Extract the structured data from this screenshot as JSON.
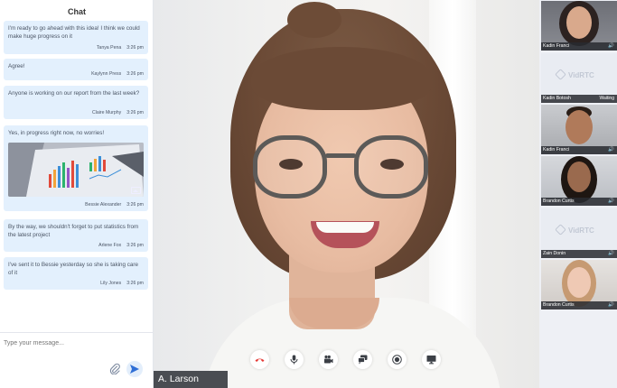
{
  "chat": {
    "title": "Chat",
    "messages": [
      {
        "text": "I'm ready to go ahead with this idea! I think we could make huge progress on it",
        "author": "Tanya Pena",
        "time": "3:26 pm"
      },
      {
        "text": "Agree!",
        "author": "Kaylynn Press",
        "time": "3:26 pm"
      },
      {
        "text": "Anyone is working on our report from the last week?",
        "author": "Claire Murphy",
        "time": "3:26 pm"
      },
      {
        "text": "Yes, in progress right now, no worries!",
        "author": "Bessie Alexander",
        "time": "3:26 pm"
      },
      {
        "text": "By the way, we shouldn't forget to put statistics from the latest project",
        "author": "Arlene Fox",
        "time": "3:26 pm"
      },
      {
        "text": "I've sent it to Bessie yesterday so she is taking care of it",
        "author": "Lily Jones",
        "time": "3:26 pm"
      }
    ],
    "input_placeholder": "Type your message..."
  },
  "main_video": {
    "speaker_name": "A. Larson",
    "controls": [
      "hang-up",
      "microphone",
      "camera",
      "chat",
      "record",
      "share-screen"
    ]
  },
  "participants": [
    {
      "name": "Kadin Franci",
      "status": "",
      "has_video": true
    },
    {
      "name": "Kadin Botosh",
      "status": "Waiting",
      "has_video": false,
      "placeholder_logo": "VidRTC"
    },
    {
      "name": "Kadin Franci",
      "status": "",
      "has_video": true
    },
    {
      "name": "Brandon Curtis",
      "status": "",
      "has_video": true
    },
    {
      "name": "Zain Donin",
      "status": "",
      "has_video": false,
      "placeholder_logo": "VidRTC"
    },
    {
      "name": "Brandon Curtis",
      "status": "",
      "has_video": true
    }
  ],
  "colors": {
    "message_bubble": "#e3f0fd",
    "hang_up": "#e53935",
    "accent": "#2f6fd6",
    "name_label_bg": "#4a4d52"
  }
}
